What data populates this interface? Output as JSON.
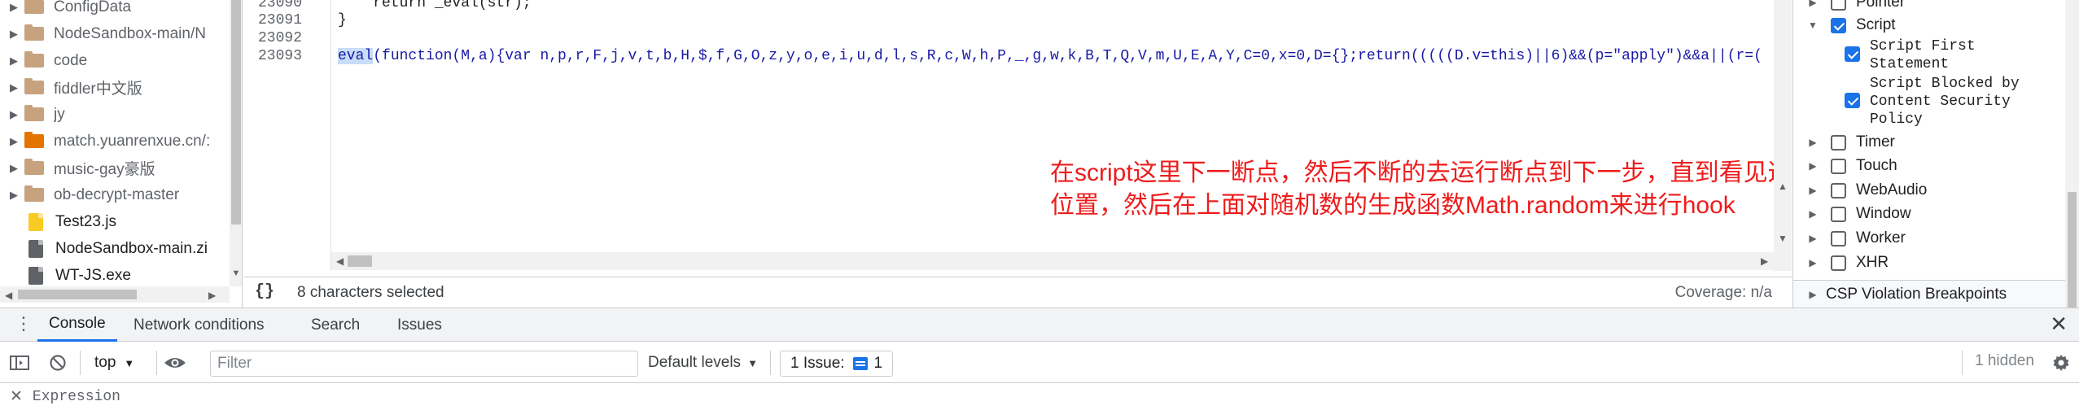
{
  "navigator": {
    "items": [
      {
        "label": "ConfigData",
        "type": "folder",
        "color": "#c7a27f",
        "expandable": true
      },
      {
        "label": "NodeSandbox-main/N",
        "type": "folder",
        "color": "#c7a27f",
        "expandable": true
      },
      {
        "label": "code",
        "type": "folder",
        "color": "#c7a27f",
        "expandable": true
      },
      {
        "label": "fiddler中文版",
        "type": "folder",
        "color": "#c7a27f",
        "expandable": true
      },
      {
        "label": "jy",
        "type": "folder",
        "color": "#c7a27f",
        "expandable": true
      },
      {
        "label": "match.yuanrenxue.cn/:",
        "type": "folder",
        "color": "#e37400",
        "expandable": true
      },
      {
        "label": "music-gay豪版",
        "type": "folder",
        "color": "#c7a27f",
        "expandable": true
      },
      {
        "label": "ob-decrypt-master",
        "type": "folder",
        "color": "#c7a27f",
        "expandable": true
      },
      {
        "label": "Test23.js",
        "type": "file",
        "color": "#f9ca24",
        "expandable": false
      },
      {
        "label": "NodeSandbox-main.zi",
        "type": "file",
        "color": "#5f6368",
        "expandable": false
      },
      {
        "label": "WT-JS.exe",
        "type": "file",
        "color": "#5f6368",
        "expandable": false
      }
    ]
  },
  "editor": {
    "line_numbers": [
      "23090",
      "23091",
      "23092",
      "23093"
    ],
    "line_23090": "    return _eval(str);",
    "line_23091": "}",
    "eval_selected": "eval",
    "line_23093_rest": "(function(M,a){var n,p,r,F,j,v,t,b,H,$,f,G,O,z,y,o,e,i,u,d,l,s,R,c,W,h,P,_,g,w,k,B,T,Q,V,m,U,E,A,Y,C=0,x=0,D={};return(((((D.v=this)||6)&&(p=\"apply\")&&a||(r=(",
    "annotation_line1": "在script这里下一断点，然后不断的去运行断点到下一步，直到看见这个",
    "annotation_line2": "位置，然后在上面对随机数的生成函数Math.random来进行hook"
  },
  "status_bar": {
    "braces": "{}",
    "selection": "8 characters selected",
    "coverage": "Coverage: n/a"
  },
  "breakpoints": {
    "pointer": "Pointer",
    "script": "Script",
    "script_first_statement_1": "Script First",
    "script_first_statement_2": "Statement",
    "script_blocked_1": "Script Blocked by",
    "script_blocked_2": "Content Security",
    "script_blocked_3": "Policy",
    "timer": "Timer",
    "touch": "Touch",
    "webaudio": "WebAudio",
    "window": "Window",
    "worker": "Worker",
    "xhr": "XHR",
    "csp": "CSP Violation Breakpoints"
  },
  "drawer": {
    "tabs": [
      "Console",
      "Network conditions",
      "Search",
      "Issues"
    ],
    "active_tab": "Console",
    "close": "✕"
  },
  "console_toolbar": {
    "context": "top",
    "filter_placeholder": "Filter",
    "levels": "Default levels",
    "issues_label": "1 Issue:",
    "issues_count": "1",
    "hidden": "1 hidden"
  },
  "expression": {
    "close": "✕",
    "label": "Expression"
  },
  "colors": {
    "accent": "#1a73e8",
    "annotation": "#ee1c1c",
    "selection": "#c8ddf8"
  }
}
